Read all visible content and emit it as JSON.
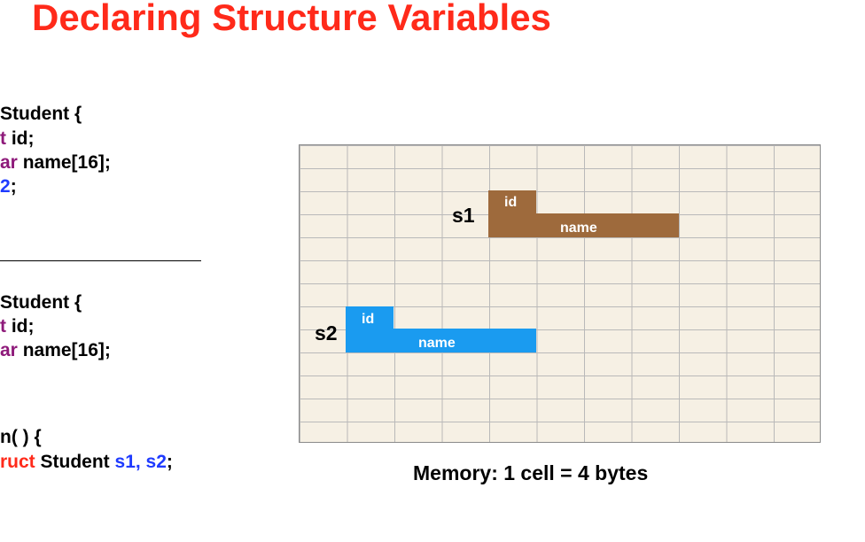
{
  "title": "Declaring Structure Variables",
  "code": {
    "block1": {
      "line1": "Student {",
      "line2_kw": "t",
      "line2_rest": " id;",
      "line3_kw": "ar",
      "line3_rest": " name[16];",
      "line4_kw": "2",
      "line4_rest": ";"
    },
    "block2": {
      "line1": "Student {",
      "line2_kw": "t",
      "line2_rest": " id;",
      "line3_kw": "ar",
      "line3_rest": " name[16];"
    },
    "block3": {
      "line1": "n( ) {",
      "line2_kw": "ruct",
      "line2_mid": " Student ",
      "line2_vars": "s1, s2",
      "line2_end": ";"
    }
  },
  "memory": {
    "s1": {
      "label": "s1",
      "id_label": "id",
      "name_label": "name",
      "color": "#9e6a3c"
    },
    "s2": {
      "label": "s2",
      "id_label": "id",
      "name_label": "name",
      "color": "#1a9bf0"
    },
    "grid_color": "#f6f0e4",
    "caption": "Memory: 1 cell = 4 bytes"
  }
}
